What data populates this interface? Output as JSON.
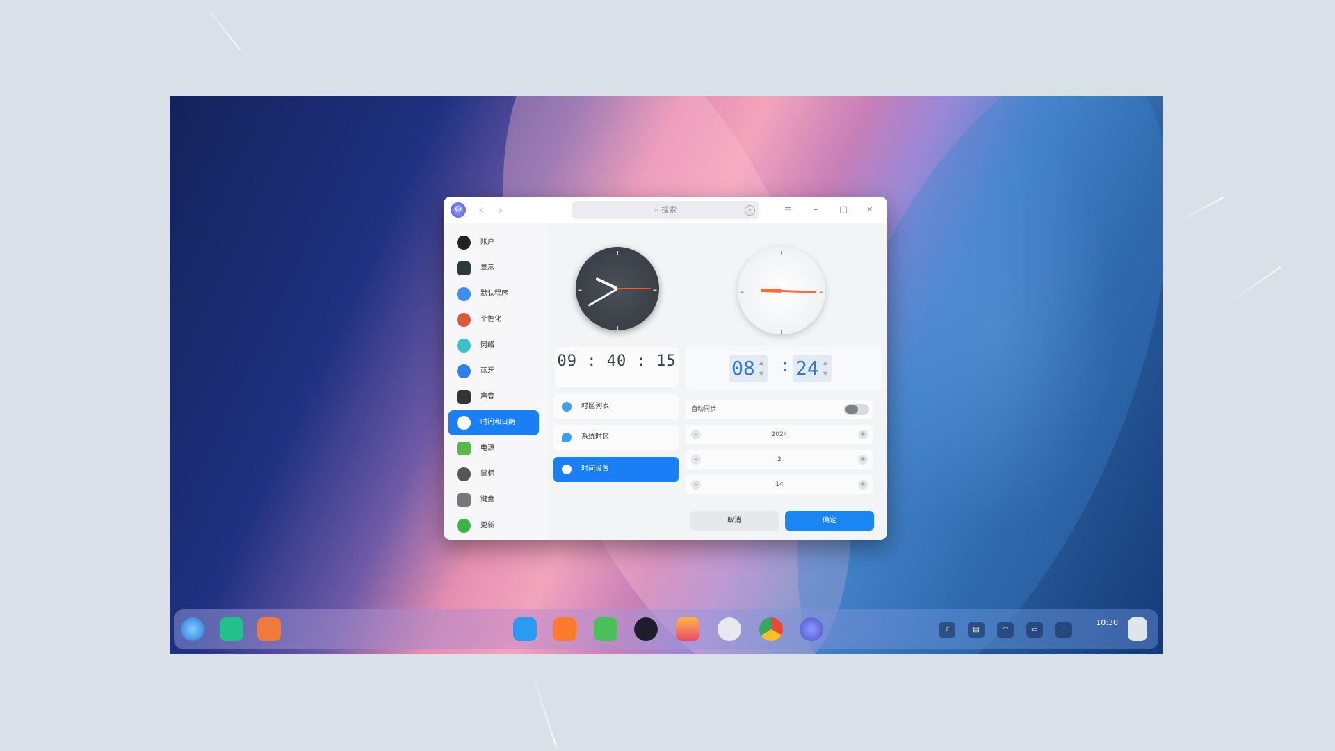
{
  "window": {
    "search_placeholder": "搜索",
    "sidebar": {
      "items": [
        {
          "label": "账户",
          "icon": "user-icon",
          "color": "#222222"
        },
        {
          "label": "显示",
          "icon": "monitor-icon",
          "color": "#2d3a3a"
        },
        {
          "label": "默认程序",
          "icon": "default-apps-icon",
          "color": "#3d8ef0"
        },
        {
          "label": "个性化",
          "icon": "personalization-icon",
          "color": "#d85a3a"
        },
        {
          "label": "网络",
          "icon": "network-icon",
          "color": "#3cc1c8"
        },
        {
          "label": "蓝牙",
          "icon": "bluetooth-icon",
          "color": "#2f7fe6"
        },
        {
          "label": "声音",
          "icon": "sound-icon",
          "color": "#333333"
        },
        {
          "label": "时间和日期",
          "icon": "clock-icon",
          "color": "#ffffff"
        },
        {
          "label": "电源",
          "icon": "power-icon",
          "color": "#5ab84a"
        },
        {
          "label": "鼠标",
          "icon": "mouse-icon",
          "color": "#555555"
        },
        {
          "label": "键盘",
          "icon": "keyboard-icon",
          "color": "#777777"
        },
        {
          "label": "更新",
          "icon": "update-icon",
          "color": "#3cb44a"
        }
      ],
      "active_index": 7
    },
    "current_time": "09 : 40 : 15",
    "menu": [
      {
        "label": "时区列表"
      },
      {
        "label": "系统时区"
      },
      {
        "label": "时间设置"
      }
    ],
    "edit": {
      "hour": "08",
      "minute": "24",
      "auto_sync_label": "自动同步",
      "year": "2024",
      "month": "2",
      "day": "14"
    },
    "buttons": {
      "cancel": "取消",
      "confirm": "确定"
    }
  },
  "dock": {
    "left_icons": [
      "launcher-icon",
      "file-manager-icon",
      "app-store-icon"
    ],
    "center_icons": [
      "store-icon",
      "browser-icon",
      "music-icon",
      "video-icon",
      "photos-icon",
      "camera-icon",
      "chrome-icon",
      "settings-icon"
    ],
    "tray_icons": [
      "volume-icon",
      "input-icon",
      "wifi-icon",
      "battery-icon",
      "notification-icon"
    ],
    "clock": "10:30"
  },
  "colors": {
    "accent": "#1a7ff5"
  }
}
